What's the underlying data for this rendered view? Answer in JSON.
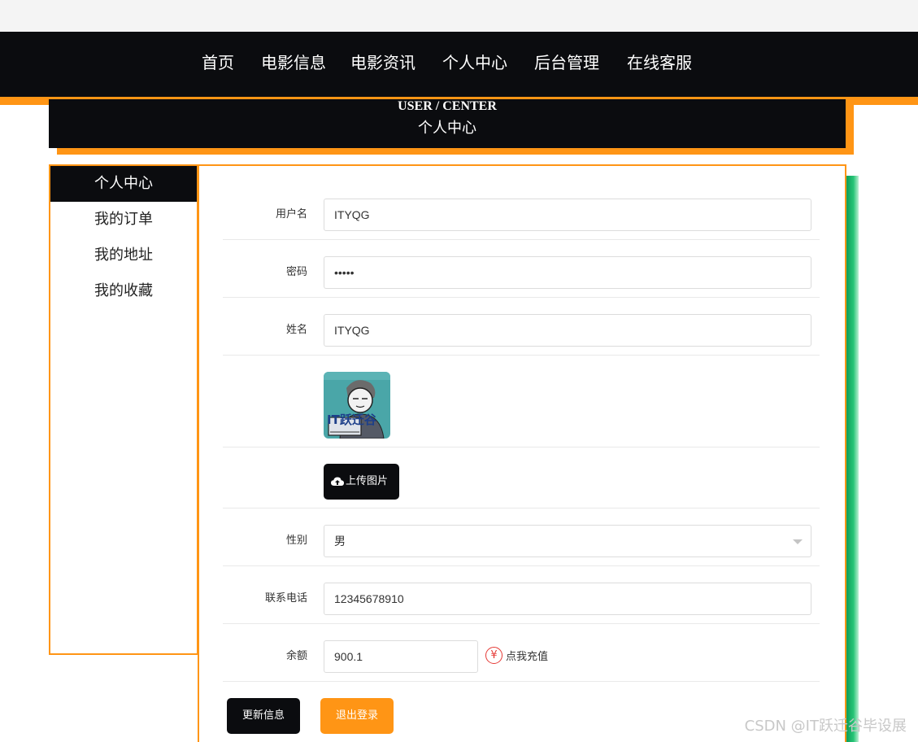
{
  "nav": {
    "items": [
      "首页",
      "电影信息",
      "电影资讯",
      "个人中心",
      "后台管理",
      "在线客服"
    ]
  },
  "banner": {
    "title_en": "USER / CENTER",
    "title_cn": "个人中心"
  },
  "sidebar": {
    "items": [
      "个人中心",
      "我的订单",
      "我的地址",
      "我的收藏"
    ],
    "active": "个人中心"
  },
  "form": {
    "username": {
      "label": "用户名",
      "value": "ITYQG"
    },
    "password": {
      "label": "密码",
      "value": "•••••"
    },
    "name": {
      "label": "姓名",
      "value": "ITYQG"
    },
    "avatar_text": "IT跃迁谷",
    "upload_label": "上传图片",
    "gender": {
      "label": "性别",
      "value": "男"
    },
    "phone": {
      "label": "联系电话",
      "value": "12345678910"
    },
    "balance": {
      "label": "余额",
      "value": "900.1",
      "currency_symbol": "¥",
      "recharge_label": "点我充值"
    },
    "update_label": "更新信息",
    "logout_label": "退出登录"
  },
  "watermark": "CSDN @IT跃迁谷毕设展",
  "colors": {
    "accent": "#ff9515",
    "dark": "#0b0c0f",
    "green": "#27c476",
    "yen": "#e53935"
  }
}
